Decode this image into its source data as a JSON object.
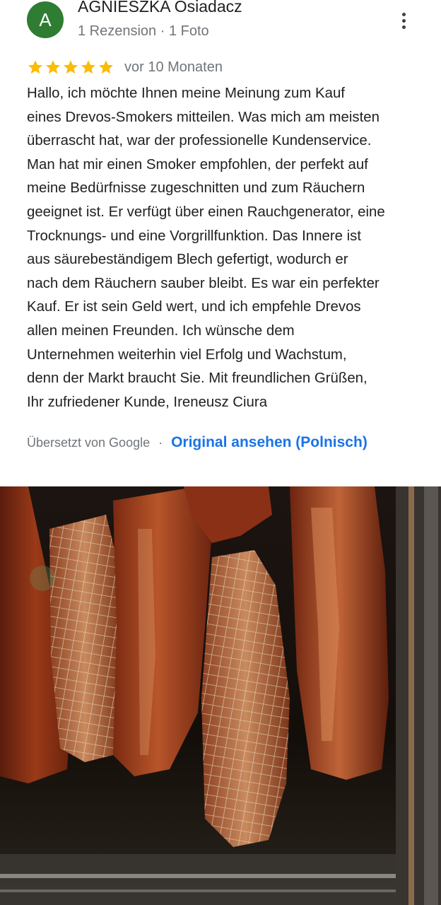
{
  "reviewer": {
    "initial": "A",
    "avatar_color": "#2e7d32",
    "name": "AGNIESZKA Osiadacz",
    "meta": "1 Rezension · 1 Foto"
  },
  "menu": {
    "icon": "more-vert-icon"
  },
  "review": {
    "rating": 5,
    "rating_max": 5,
    "star_color": "#fbbc04",
    "date": "vor 10 Monaten",
    "text_lines": [
      "Hallo, ich möchte Ihnen meine Meinung zum Kauf",
      "eines Drevos-Smokers mitteilen. Was mich am meisten",
      "überrascht hat, war der professionelle Kundenservice.",
      "Man hat mir einen Smoker empfohlen, der perfekt auf",
      "meine Bedürfnisse zugeschnitten und zum Räuchern",
      "geeignet ist. Er verfügt über einen Rauchgenerator, eine",
      "Trocknungs- und eine Vorgrillfunktion. Das Innere ist",
      "aus säurebeständigem Blech gefertigt, wodurch er",
      "nach dem Räuchern sauber bleibt. Es war ein perfekter",
      "Kauf. Er ist sein Geld wert, und ich empfehle Drevos",
      "allen meinen Freunden. Ich wünsche dem",
      "Unternehmen weiterhin viel Erfolg und Wachstum,",
      "denn der Markt braucht Sie. Mit freundlichen Grüßen,",
      "Ihr zufriedener Kunde, Ireneusz Ciura"
    ]
  },
  "translation": {
    "translated_by": "Übersetzt von Google",
    "separator": "·",
    "original_link": "Original ansehen (Polnisch)",
    "link_color": "#1a73e8"
  }
}
